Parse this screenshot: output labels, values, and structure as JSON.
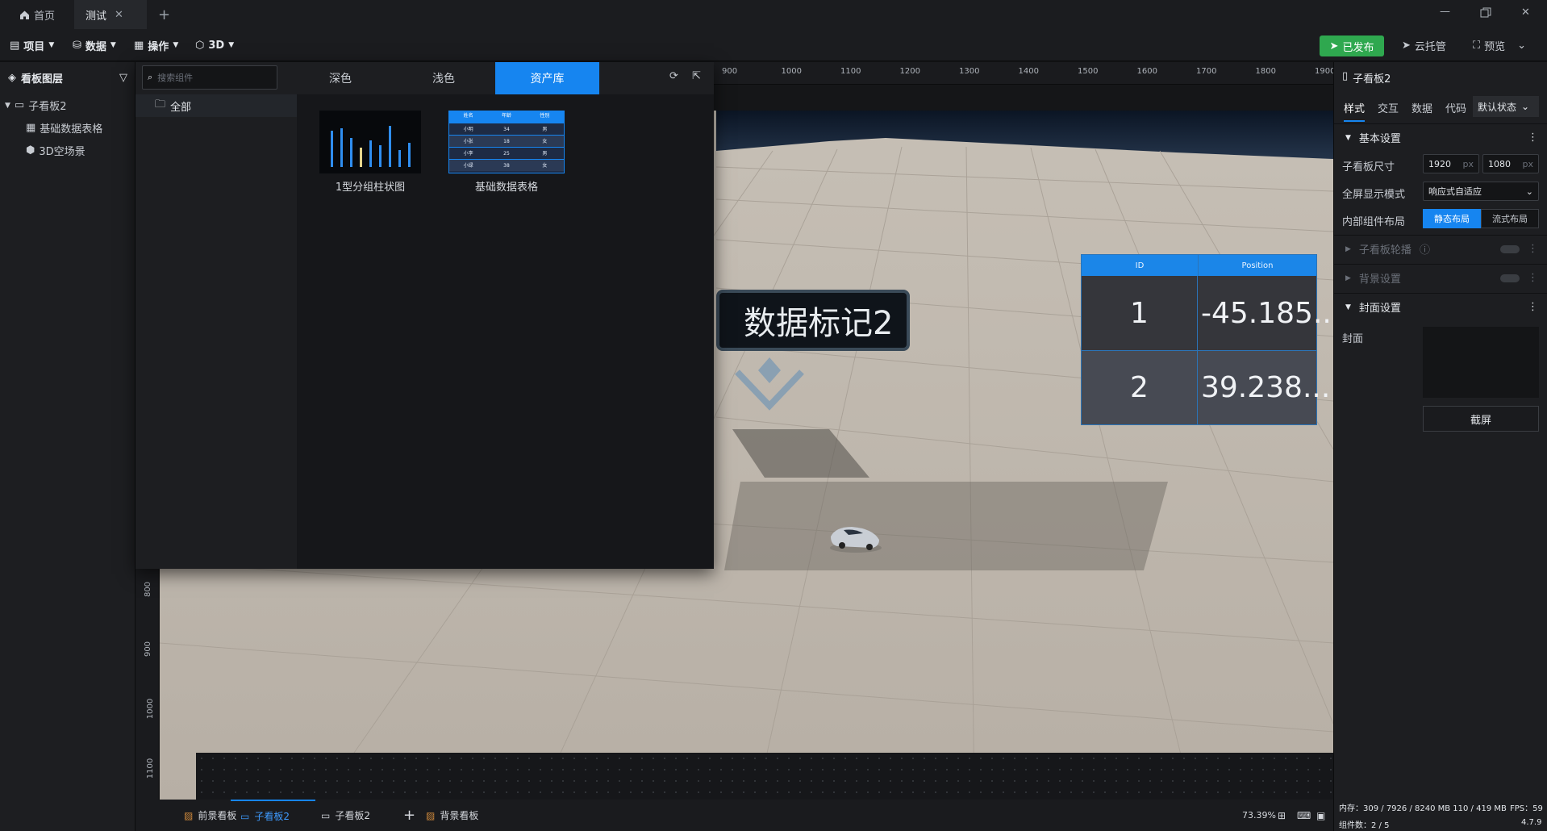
{
  "tabs": [
    {
      "label": "首页"
    },
    {
      "label": "测试"
    }
  ],
  "menubar": {
    "project": "项目",
    "data": "数据",
    "operate": "操作",
    "three_d": "3D",
    "publish": "已发布",
    "cloud": "云托管",
    "preview": "预览"
  },
  "layers": {
    "title": "看板图层",
    "root": "子看板2",
    "items": [
      "基础数据表格",
      "3D空场景"
    ]
  },
  "asset_panel": {
    "search_placeholder": "搜索组件",
    "tabs": [
      "深色",
      "浅色",
      "资产库"
    ],
    "active_tab": "资产库",
    "folder": "全部",
    "cards": [
      {
        "label": "1型分组柱状图",
        "values": [
          75,
          80,
          60,
          40,
          55,
          45,
          85,
          35,
          50
        ]
      },
      {
        "label": "基础数据表格",
        "header": [
          "姓名",
          "年龄",
          "性别"
        ],
        "rows": [
          [
            "小明",
            "34",
            "男"
          ],
          [
            "小张",
            "18",
            "女"
          ],
          [
            "小李",
            "25",
            "男"
          ],
          [
            "小绿",
            "38",
            "女"
          ]
        ]
      }
    ]
  },
  "ruler": {
    "top_ticks": [
      "900",
      "1000",
      "1100",
      "1200",
      "1300",
      "1400",
      "1500",
      "1600",
      "1700",
      "1800",
      "1900"
    ],
    "left_ticks": [
      "800",
      "900",
      "1000",
      "1100"
    ]
  },
  "scene": {
    "marker_label": "数据标记2",
    "table": {
      "headers": [
        "ID",
        "Position"
      ],
      "rows": [
        [
          "1",
          "-45.185..."
        ],
        [
          "2",
          "39.238..."
        ]
      ]
    }
  },
  "right_panel": {
    "title": "子看板2",
    "tabs": [
      "样式",
      "交互",
      "数据",
      "代码"
    ],
    "state_select": "默认状态",
    "basic_section": "基本设置",
    "size_label": "子看板尺寸",
    "width": "1920",
    "height": "1080",
    "unit": "px",
    "fullscreen_label": "全屏显示模式",
    "fullscreen_value": "响应式自适应",
    "layout_label": "内部组件布局",
    "layout_static": "静态布局",
    "layout_flow": "流式布局",
    "outline_section": "子看板轮播",
    "bg_section": "背景设置",
    "cover_section": "封面设置",
    "cover_label": "封面",
    "screenshot_button": "截屏"
  },
  "bottom_tabs": [
    {
      "label": "前景看板"
    },
    {
      "label": "子看板2"
    },
    {
      "label": "子看板2"
    },
    {
      "label": "背景看板"
    }
  ],
  "status": {
    "zoom": "73.39%",
    "memory": "内存：309 / 7926 / 8240 MB  110 / 419 MB",
    "fps": "FPS：59",
    "components": "组件数：2 / 5",
    "version": "4.7.9"
  },
  "colors": {
    "accent": "#1685f0",
    "publish": "#2fa84f"
  }
}
